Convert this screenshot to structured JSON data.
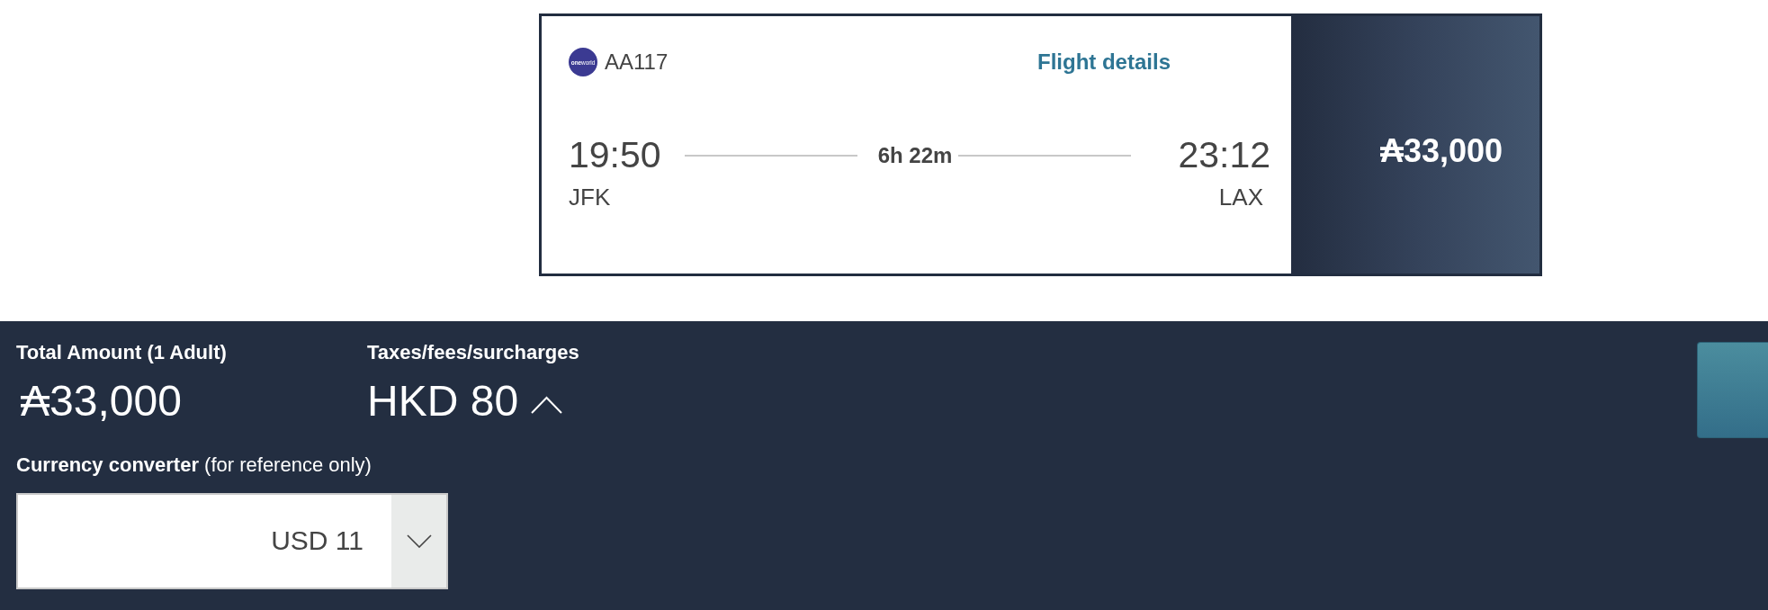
{
  "flight_card": {
    "logo_text": "**one**world",
    "flight_number": "AA117",
    "details_link": "Flight details",
    "departure": {
      "time": "19:50",
      "airport": "JFK"
    },
    "duration": "6h 22m",
    "arrival": {
      "time": "23:12",
      "airport": "LAX"
    },
    "price": "₳33,000"
  },
  "summary": {
    "total_label": "Total Amount (1 Adult)",
    "total": "₳33,000",
    "taxes_label": "Taxes/fees/surcharges",
    "taxes": "HKD 80"
  },
  "currency_converter": {
    "label": "**Currency converter** (for reference only)",
    "value": "USD 11"
  }
}
